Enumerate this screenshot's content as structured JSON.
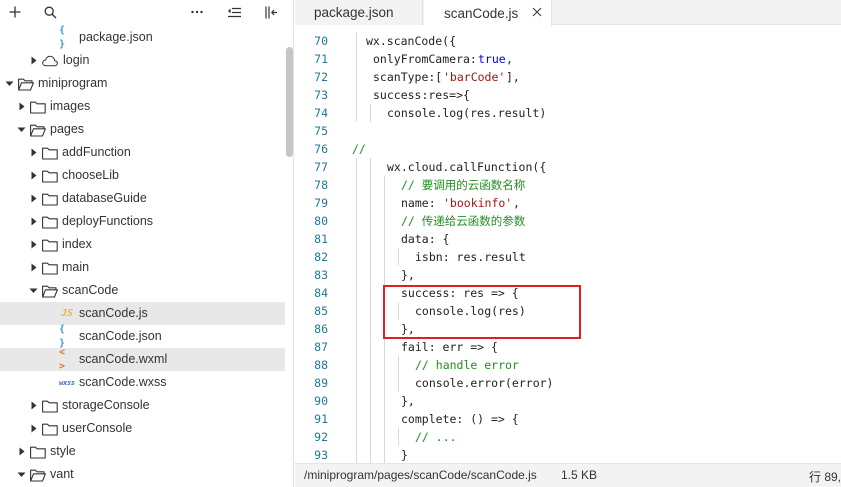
{
  "sidebar": {
    "toolbar": {
      "add_icon": "plus-icon",
      "search_icon": "search-icon",
      "more_icon": "ellipsis-icon",
      "collapse_icon": "collapse-all-icon",
      "panel_icon": "sidebar-toggle-icon"
    },
    "tree": [
      {
        "label": "package.json",
        "kind": "json",
        "depth": 3,
        "chevron": "none",
        "icon_glyph": "{ }"
      },
      {
        "label": "login",
        "kind": "cloud-folder",
        "depth": 2,
        "chevron": "right"
      },
      {
        "label": "miniprogram",
        "kind": "folder",
        "depth": 0,
        "chevron": "down"
      },
      {
        "label": "images",
        "kind": "folder",
        "depth": 1,
        "chevron": "right"
      },
      {
        "label": "pages",
        "kind": "folder",
        "depth": 1,
        "chevron": "down"
      },
      {
        "label": "addFunction",
        "kind": "folder",
        "depth": 2,
        "chevron": "right"
      },
      {
        "label": "chooseLib",
        "kind": "folder",
        "depth": 2,
        "chevron": "right"
      },
      {
        "label": "databaseGuide",
        "kind": "folder",
        "depth": 2,
        "chevron": "right"
      },
      {
        "label": "deployFunctions",
        "kind": "folder",
        "depth": 2,
        "chevron": "right"
      },
      {
        "label": "index",
        "kind": "folder",
        "depth": 2,
        "chevron": "right"
      },
      {
        "label": "main",
        "kind": "folder",
        "depth": 2,
        "chevron": "right"
      },
      {
        "label": "scanCode",
        "kind": "folder",
        "depth": 2,
        "chevron": "down"
      },
      {
        "label": "scanCode.js",
        "kind": "js",
        "depth": 3,
        "chevron": "none",
        "selected": true,
        "icon_glyph": "JS"
      },
      {
        "label": "scanCode.json",
        "kind": "json",
        "depth": 3,
        "chevron": "none",
        "icon_glyph": "{ }"
      },
      {
        "label": "scanCode.wxml",
        "kind": "wxml",
        "depth": 3,
        "chevron": "none",
        "selected": true,
        "icon_glyph": "< >"
      },
      {
        "label": "scanCode.wxss",
        "kind": "wxss",
        "depth": 3,
        "chevron": "none",
        "icon_glyph": "wxss"
      },
      {
        "label": "storageConsole",
        "kind": "folder",
        "depth": 2,
        "chevron": "right"
      },
      {
        "label": "userConsole",
        "kind": "folder",
        "depth": 2,
        "chevron": "right"
      },
      {
        "label": "style",
        "kind": "folder",
        "depth": 1,
        "chevron": "right"
      },
      {
        "label": "vant",
        "kind": "folder",
        "depth": 1,
        "chevron": "down"
      }
    ]
  },
  "editor": {
    "tabs": [
      {
        "label": "package.json",
        "active": false
      },
      {
        "label": "scanCode.js",
        "active": true,
        "close_icon": "close-icon"
      }
    ],
    "lines": [
      {
        "n": "70",
        "indent": 1,
        "segs": [
          {
            "t": "wx.scanCode({",
            "c": ""
          }
        ]
      },
      {
        "n": "71",
        "indent": 1.5,
        "segs": [
          {
            "t": "onlyFromCamera:",
            "c": ""
          },
          {
            "t": "true",
            "c": "bool"
          },
          {
            "t": ",",
            "c": ""
          }
        ]
      },
      {
        "n": "72",
        "indent": 1.5,
        "segs": [
          {
            "t": "scanType:[",
            "c": ""
          },
          {
            "t": "'barCode'",
            "c": "str"
          },
          {
            "t": "],",
            "c": ""
          }
        ]
      },
      {
        "n": "73",
        "indent": 1.5,
        "segs": [
          {
            "t": "success:res=>{",
            "c": ""
          }
        ]
      },
      {
        "n": "74",
        "indent": 2.5,
        "segs": [
          {
            "t": "console.log(res.result)",
            "c": ""
          }
        ]
      },
      {
        "n": "75",
        "indent": 0,
        "segs": []
      },
      {
        "n": "76",
        "indent": 0,
        "segs": [
          {
            "t": "//",
            "c": "cmt"
          }
        ]
      },
      {
        "n": "77",
        "indent": 2.5,
        "segs": [
          {
            "t": "wx.cloud.callFunction({",
            "c": ""
          }
        ]
      },
      {
        "n": "78",
        "indent": 3.5,
        "segs": [
          {
            "t": "// 要调用的云函数名称",
            "c": "cmt"
          }
        ]
      },
      {
        "n": "79",
        "indent": 3.5,
        "segs": [
          {
            "t": "name: ",
            "c": ""
          },
          {
            "t": "'bookinfo'",
            "c": "str"
          },
          {
            "t": ",",
            "c": ""
          }
        ]
      },
      {
        "n": "80",
        "indent": 3.5,
        "segs": [
          {
            "t": "// 传递给云函数的参数",
            "c": "cmt"
          }
        ]
      },
      {
        "n": "81",
        "indent": 3.5,
        "segs": [
          {
            "t": "data: {",
            "c": ""
          }
        ]
      },
      {
        "n": "82",
        "indent": 4.5,
        "segs": [
          {
            "t": "isbn: res.result",
            "c": ""
          }
        ]
      },
      {
        "n": "83",
        "indent": 3.5,
        "segs": [
          {
            "t": "},",
            "c": ""
          }
        ]
      },
      {
        "n": "84",
        "indent": 3.5,
        "segs": [
          {
            "t": "success: res => {",
            "c": ""
          }
        ]
      },
      {
        "n": "85",
        "indent": 4.5,
        "segs": [
          {
            "t": "console.log(res)",
            "c": ""
          }
        ]
      },
      {
        "n": "86",
        "indent": 3.5,
        "segs": [
          {
            "t": "},",
            "c": ""
          }
        ]
      },
      {
        "n": "87",
        "indent": 3.5,
        "segs": [
          {
            "t": "fail: err => {",
            "c": ""
          }
        ]
      },
      {
        "n": "88",
        "indent": 4.5,
        "segs": [
          {
            "t": "// handle error",
            "c": "cmt"
          }
        ]
      },
      {
        "n": "89",
        "indent": 4.5,
        "segs": [
          {
            "t": "console.error(error)",
            "c": ""
          }
        ]
      },
      {
        "n": "90",
        "indent": 3.5,
        "segs": [
          {
            "t": "},",
            "c": ""
          }
        ]
      },
      {
        "n": "91",
        "indent": 3.5,
        "segs": [
          {
            "t": "complete: () => {",
            "c": ""
          }
        ]
      },
      {
        "n": "92",
        "indent": 4.5,
        "segs": [
          {
            "t": "// ...",
            "c": "cmt"
          }
        ]
      },
      {
        "n": "93",
        "indent": 3.5,
        "segs": [
          {
            "t": "}",
            "c": ""
          }
        ]
      }
    ]
  },
  "statusbar": {
    "path": "/miniprogram/pages/scanCode/scanCode.js",
    "size": "1.5 KB",
    "position": "行 89,"
  },
  "colors": {
    "highlight_border": "#e02020",
    "line_number": "#237893",
    "comment": "#1f8f1f",
    "string": "#a31515",
    "keyword": "#0000ff"
  }
}
